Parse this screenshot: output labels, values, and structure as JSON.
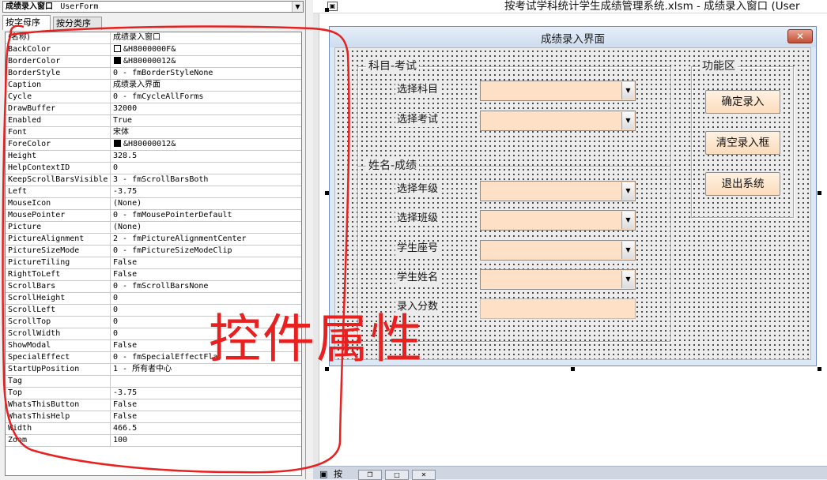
{
  "properties_window": {
    "object_name": "成绩录入窗口",
    "object_type": "UserForm",
    "tabs": [
      "按字母序",
      "按分类序"
    ],
    "rows": [
      {
        "name": "(名称)",
        "value": "成绩录入窗口"
      },
      {
        "name": "BackColor",
        "value": "&H8000000F&"
      },
      {
        "name": "BorderColor",
        "value": "&H80000012&"
      },
      {
        "name": "BorderStyle",
        "value": "0 - fmBorderStyleNone"
      },
      {
        "name": "Caption",
        "value": "成绩录入界面"
      },
      {
        "name": "Cycle",
        "value": "0 - fmCycleAllForms"
      },
      {
        "name": "DrawBuffer",
        "value": "32000"
      },
      {
        "name": "Enabled",
        "value": "True"
      },
      {
        "name": "Font",
        "value": "宋体"
      },
      {
        "name": "ForeColor",
        "value": "&H80000012&"
      },
      {
        "name": "Height",
        "value": "328.5"
      },
      {
        "name": "HelpContextID",
        "value": "0"
      },
      {
        "name": "KeepScrollBarsVisible",
        "value": "3 - fmScrollBarsBoth"
      },
      {
        "name": "Left",
        "value": "-3.75"
      },
      {
        "name": "MouseIcon",
        "value": "(None)"
      },
      {
        "name": "MousePointer",
        "value": "0 - fmMousePointerDefault"
      },
      {
        "name": "Picture",
        "value": "(None)"
      },
      {
        "name": "PictureAlignment",
        "value": "2 - fmPictureAlignmentCenter"
      },
      {
        "name": "PictureSizeMode",
        "value": "0 - fmPictureSizeModeClip"
      },
      {
        "name": "PictureTiling",
        "value": "False"
      },
      {
        "name": "RightToLeft",
        "value": "False"
      },
      {
        "name": "ScrollBars",
        "value": "0 - fmScrollBarsNone"
      },
      {
        "name": "ScrollHeight",
        "value": "0"
      },
      {
        "name": "ScrollLeft",
        "value": "0"
      },
      {
        "name": "ScrollTop",
        "value": "0"
      },
      {
        "name": "ScrollWidth",
        "value": "0"
      },
      {
        "name": "ShowModal",
        "value": "False"
      },
      {
        "name": "SpecialEffect",
        "value": "0 - fmSpecialEffectFla"
      },
      {
        "name": "StartUpPosition",
        "value": "1 - 所有者中心"
      },
      {
        "name": "Tag",
        "value": ""
      },
      {
        "name": "Top",
        "value": "-3.75"
      },
      {
        "name": "WhatsThisButton",
        "value": "False"
      },
      {
        "name": "WhatsThisHelp",
        "value": "False"
      },
      {
        "name": "Width",
        "value": "466.5"
      },
      {
        "name": "Zoom",
        "value": "100"
      }
    ],
    "swatch_colors": {
      "BackColor": "#ffffff",
      "BorderColor": "#000000",
      "ForeColor": "#000000"
    }
  },
  "designer": {
    "window_title": "按考试学科统计学生成绩管理系统.xlsm - 成绩录入窗口 (User",
    "bottom_title": "按"
  },
  "form": {
    "caption": "成绩录入界面",
    "close_glyph": "✕",
    "frame_subject": {
      "caption": "科目-考试",
      "labels": [
        "选择科目",
        "选择考试"
      ]
    },
    "frame_student": {
      "caption": "姓名-成绩",
      "labels": [
        "选择年级",
        "选择班级",
        "学生座号",
        "学生姓名",
        "录入分数"
      ]
    },
    "frame_function": {
      "caption": "功能区",
      "buttons": [
        "确定录入",
        "清空录入框",
        "退出系统"
      ]
    }
  },
  "annotation": {
    "text": "控件属性",
    "color": "#e82020"
  },
  "colors": {
    "input_fill": "#fde0c6",
    "form_border": "#6f8fb8",
    "close_button": "#c24e33"
  }
}
